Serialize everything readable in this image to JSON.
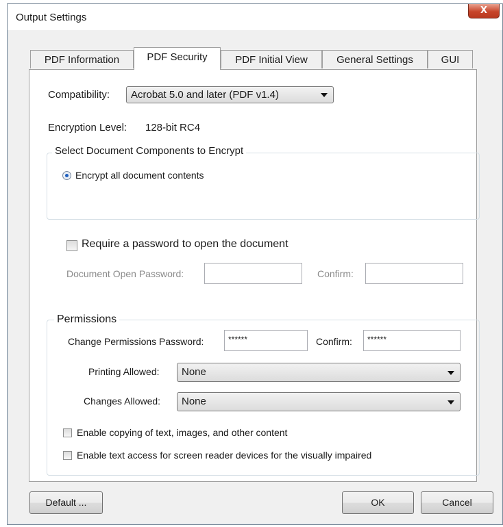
{
  "window": {
    "title": "Output Settings",
    "close_glyph": "X"
  },
  "tabs": [
    {
      "label": "PDF Information",
      "active": false
    },
    {
      "label": "PDF Security",
      "active": true
    },
    {
      "label": "PDF Initial View",
      "active": false
    },
    {
      "label": "General Settings",
      "active": false
    },
    {
      "label": "GUI",
      "active": false
    }
  ],
  "compatibility": {
    "label": "Compatibility:",
    "value": "Acrobat 5.0 and later (PDF v1.4)"
  },
  "encryption": {
    "label": "Encryption Level:",
    "value": "128-bit RC4"
  },
  "components": {
    "legend": "Select Document Components to Encrypt",
    "radio_label": "Encrypt all document contents",
    "selected": true
  },
  "open_password": {
    "checkbox_label": "Require a password to open the document",
    "checked": false,
    "password_label": "Document Open Password:",
    "password_value": "",
    "confirm_label": "Confirm:",
    "confirm_value": ""
  },
  "permissions": {
    "legend": "Permissions",
    "password_label": "Change Permissions Password:",
    "password_value": "******",
    "confirm_label": "Confirm:",
    "confirm_value": "******",
    "printing_label": "Printing Allowed:",
    "printing_value": "None",
    "changes_label": "Changes Allowed:",
    "changes_value": "None",
    "copy_label": "Enable copying of text, images, and other content",
    "copy_checked": false,
    "reader_label": "Enable text access for screen reader devices for the visually impaired",
    "reader_checked": false
  },
  "buttons": {
    "default": "Default ...",
    "ok": "OK",
    "cancel": "Cancel"
  }
}
